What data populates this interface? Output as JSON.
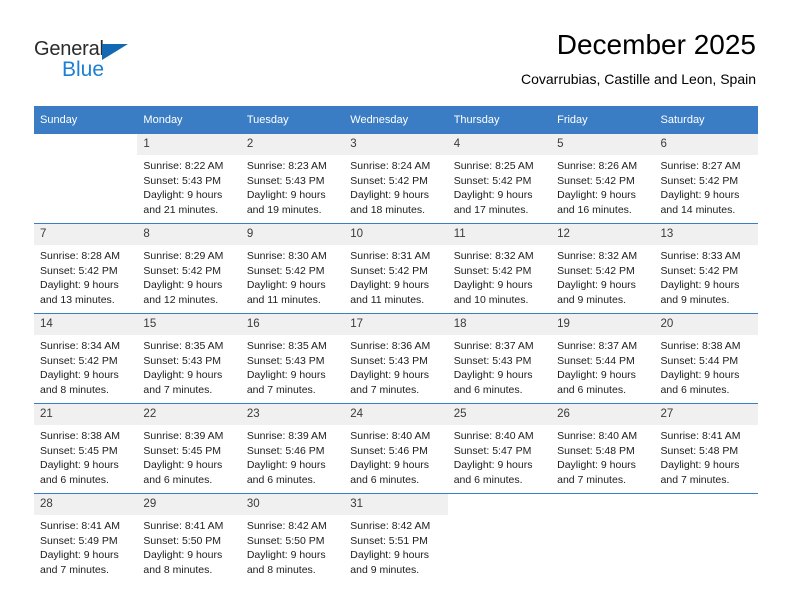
{
  "brand": {
    "name_part1": "General",
    "name_part2": "Blue",
    "triangle_icon": "triangle-icon",
    "accent_color": "#1b7fd4",
    "header_color": "#3b7dc4"
  },
  "header": {
    "title": "December 2025",
    "subtitle": "Covarrubias, Castille and Leon, Spain"
  },
  "weekday_headers": [
    "Sunday",
    "Monday",
    "Tuesday",
    "Wednesday",
    "Thursday",
    "Friday",
    "Saturday"
  ],
  "weeks": [
    {
      "days": [
        {
          "num": "",
          "sunrise": "",
          "sunset": "",
          "daylight1": "",
          "daylight2": ""
        },
        {
          "num": "1",
          "sunrise": "Sunrise: 8:22 AM",
          "sunset": "Sunset: 5:43 PM",
          "daylight1": "Daylight: 9 hours",
          "daylight2": "and 21 minutes."
        },
        {
          "num": "2",
          "sunrise": "Sunrise: 8:23 AM",
          "sunset": "Sunset: 5:43 PM",
          "daylight1": "Daylight: 9 hours",
          "daylight2": "and 19 minutes."
        },
        {
          "num": "3",
          "sunrise": "Sunrise: 8:24 AM",
          "sunset": "Sunset: 5:42 PM",
          "daylight1": "Daylight: 9 hours",
          "daylight2": "and 18 minutes."
        },
        {
          "num": "4",
          "sunrise": "Sunrise: 8:25 AM",
          "sunset": "Sunset: 5:42 PM",
          "daylight1": "Daylight: 9 hours",
          "daylight2": "and 17 minutes."
        },
        {
          "num": "5",
          "sunrise": "Sunrise: 8:26 AM",
          "sunset": "Sunset: 5:42 PM",
          "daylight1": "Daylight: 9 hours",
          "daylight2": "and 16 minutes."
        },
        {
          "num": "6",
          "sunrise": "Sunrise: 8:27 AM",
          "sunset": "Sunset: 5:42 PM",
          "daylight1": "Daylight: 9 hours",
          "daylight2": "and 14 minutes."
        }
      ]
    },
    {
      "days": [
        {
          "num": "7",
          "sunrise": "Sunrise: 8:28 AM",
          "sunset": "Sunset: 5:42 PM",
          "daylight1": "Daylight: 9 hours",
          "daylight2": "and 13 minutes."
        },
        {
          "num": "8",
          "sunrise": "Sunrise: 8:29 AM",
          "sunset": "Sunset: 5:42 PM",
          "daylight1": "Daylight: 9 hours",
          "daylight2": "and 12 minutes."
        },
        {
          "num": "9",
          "sunrise": "Sunrise: 8:30 AM",
          "sunset": "Sunset: 5:42 PM",
          "daylight1": "Daylight: 9 hours",
          "daylight2": "and 11 minutes."
        },
        {
          "num": "10",
          "sunrise": "Sunrise: 8:31 AM",
          "sunset": "Sunset: 5:42 PM",
          "daylight1": "Daylight: 9 hours",
          "daylight2": "and 11 minutes."
        },
        {
          "num": "11",
          "sunrise": "Sunrise: 8:32 AM",
          "sunset": "Sunset: 5:42 PM",
          "daylight1": "Daylight: 9 hours",
          "daylight2": "and 10 minutes."
        },
        {
          "num": "12",
          "sunrise": "Sunrise: 8:32 AM",
          "sunset": "Sunset: 5:42 PM",
          "daylight1": "Daylight: 9 hours",
          "daylight2": "and 9 minutes."
        },
        {
          "num": "13",
          "sunrise": "Sunrise: 8:33 AM",
          "sunset": "Sunset: 5:42 PM",
          "daylight1": "Daylight: 9 hours",
          "daylight2": "and 9 minutes."
        }
      ]
    },
    {
      "days": [
        {
          "num": "14",
          "sunrise": "Sunrise: 8:34 AM",
          "sunset": "Sunset: 5:42 PM",
          "daylight1": "Daylight: 9 hours",
          "daylight2": "and 8 minutes."
        },
        {
          "num": "15",
          "sunrise": "Sunrise: 8:35 AM",
          "sunset": "Sunset: 5:43 PM",
          "daylight1": "Daylight: 9 hours",
          "daylight2": "and 7 minutes."
        },
        {
          "num": "16",
          "sunrise": "Sunrise: 8:35 AM",
          "sunset": "Sunset: 5:43 PM",
          "daylight1": "Daylight: 9 hours",
          "daylight2": "and 7 minutes."
        },
        {
          "num": "17",
          "sunrise": "Sunrise: 8:36 AM",
          "sunset": "Sunset: 5:43 PM",
          "daylight1": "Daylight: 9 hours",
          "daylight2": "and 7 minutes."
        },
        {
          "num": "18",
          "sunrise": "Sunrise: 8:37 AM",
          "sunset": "Sunset: 5:43 PM",
          "daylight1": "Daylight: 9 hours",
          "daylight2": "and 6 minutes."
        },
        {
          "num": "19",
          "sunrise": "Sunrise: 8:37 AM",
          "sunset": "Sunset: 5:44 PM",
          "daylight1": "Daylight: 9 hours",
          "daylight2": "and 6 minutes."
        },
        {
          "num": "20",
          "sunrise": "Sunrise: 8:38 AM",
          "sunset": "Sunset: 5:44 PM",
          "daylight1": "Daylight: 9 hours",
          "daylight2": "and 6 minutes."
        }
      ]
    },
    {
      "days": [
        {
          "num": "21",
          "sunrise": "Sunrise: 8:38 AM",
          "sunset": "Sunset: 5:45 PM",
          "daylight1": "Daylight: 9 hours",
          "daylight2": "and 6 minutes."
        },
        {
          "num": "22",
          "sunrise": "Sunrise: 8:39 AM",
          "sunset": "Sunset: 5:45 PM",
          "daylight1": "Daylight: 9 hours",
          "daylight2": "and 6 minutes."
        },
        {
          "num": "23",
          "sunrise": "Sunrise: 8:39 AM",
          "sunset": "Sunset: 5:46 PM",
          "daylight1": "Daylight: 9 hours",
          "daylight2": "and 6 minutes."
        },
        {
          "num": "24",
          "sunrise": "Sunrise: 8:40 AM",
          "sunset": "Sunset: 5:46 PM",
          "daylight1": "Daylight: 9 hours",
          "daylight2": "and 6 minutes."
        },
        {
          "num": "25",
          "sunrise": "Sunrise: 8:40 AM",
          "sunset": "Sunset: 5:47 PM",
          "daylight1": "Daylight: 9 hours",
          "daylight2": "and 6 minutes."
        },
        {
          "num": "26",
          "sunrise": "Sunrise: 8:40 AM",
          "sunset": "Sunset: 5:48 PM",
          "daylight1": "Daylight: 9 hours",
          "daylight2": "and 7 minutes."
        },
        {
          "num": "27",
          "sunrise": "Sunrise: 8:41 AM",
          "sunset": "Sunset: 5:48 PM",
          "daylight1": "Daylight: 9 hours",
          "daylight2": "and 7 minutes."
        }
      ]
    },
    {
      "days": [
        {
          "num": "28",
          "sunrise": "Sunrise: 8:41 AM",
          "sunset": "Sunset: 5:49 PM",
          "daylight1": "Daylight: 9 hours",
          "daylight2": "and 7 minutes."
        },
        {
          "num": "29",
          "sunrise": "Sunrise: 8:41 AM",
          "sunset": "Sunset: 5:50 PM",
          "daylight1": "Daylight: 9 hours",
          "daylight2": "and 8 minutes."
        },
        {
          "num": "30",
          "sunrise": "Sunrise: 8:42 AM",
          "sunset": "Sunset: 5:50 PM",
          "daylight1": "Daylight: 9 hours",
          "daylight2": "and 8 minutes."
        },
        {
          "num": "31",
          "sunrise": "Sunrise: 8:42 AM",
          "sunset": "Sunset: 5:51 PM",
          "daylight1": "Daylight: 9 hours",
          "daylight2": "and 9 minutes."
        },
        {
          "num": "",
          "sunrise": "",
          "sunset": "",
          "daylight1": "",
          "daylight2": ""
        },
        {
          "num": "",
          "sunrise": "",
          "sunset": "",
          "daylight1": "",
          "daylight2": ""
        },
        {
          "num": "",
          "sunrise": "",
          "sunset": "",
          "daylight1": "",
          "daylight2": ""
        }
      ]
    }
  ]
}
